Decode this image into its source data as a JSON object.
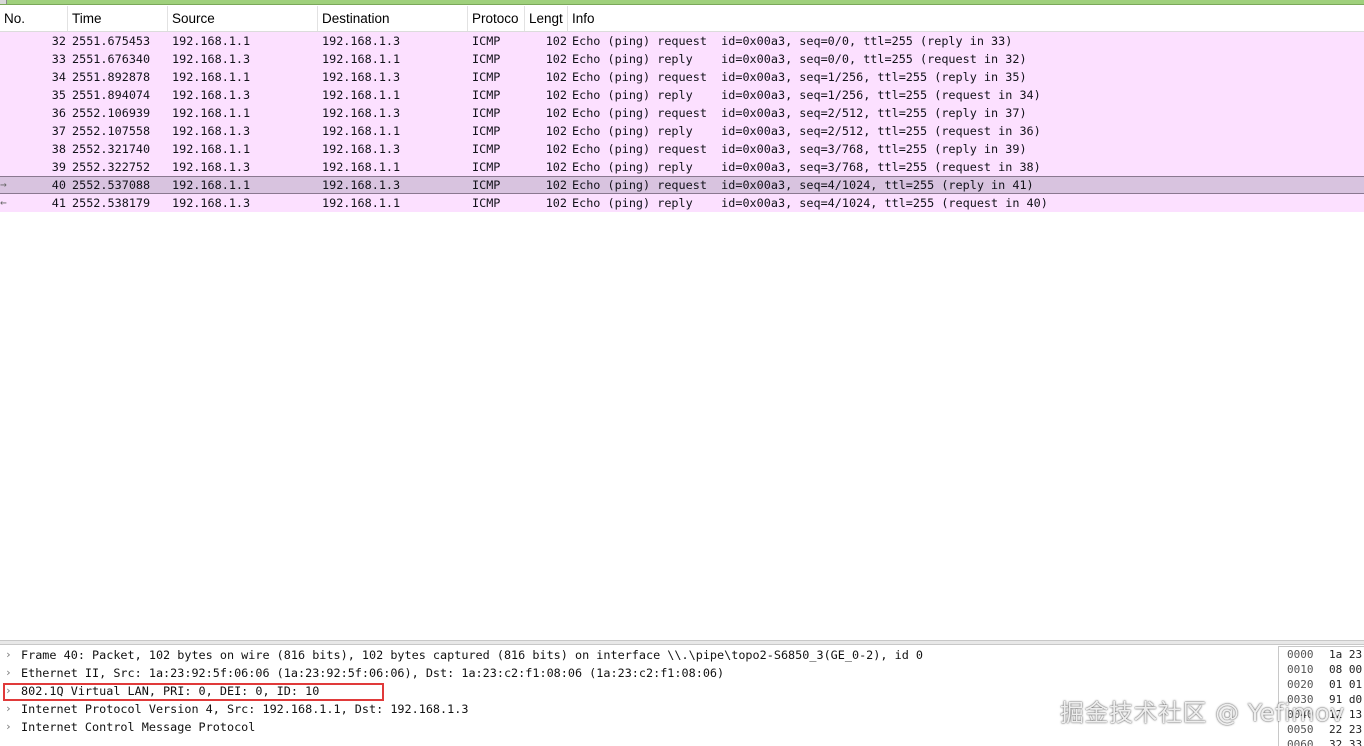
{
  "columns": {
    "no": "No.",
    "time": "Time",
    "source": "Source",
    "destination": "Destination",
    "protocol": "Protoco",
    "length": "Lengt",
    "info": "Info"
  },
  "packets": [
    {
      "no": "32",
      "time": "2551.675453",
      "src": "192.168.1.1",
      "dst": "192.168.1.3",
      "proto": "ICMP",
      "len": "102",
      "info": "Echo (ping) request  id=0x00a3, seq=0/0, ttl=255 (reply in 33)",
      "arrow": ""
    },
    {
      "no": "33",
      "time": "2551.676340",
      "src": "192.168.1.3",
      "dst": "192.168.1.1",
      "proto": "ICMP",
      "len": "102",
      "info": "Echo (ping) reply    id=0x00a3, seq=0/0, ttl=255 (request in 32)",
      "arrow": ""
    },
    {
      "no": "34",
      "time": "2551.892878",
      "src": "192.168.1.1",
      "dst": "192.168.1.3",
      "proto": "ICMP",
      "len": "102",
      "info": "Echo (ping) request  id=0x00a3, seq=1/256, ttl=255 (reply in 35)",
      "arrow": ""
    },
    {
      "no": "35",
      "time": "2551.894074",
      "src": "192.168.1.3",
      "dst": "192.168.1.1",
      "proto": "ICMP",
      "len": "102",
      "info": "Echo (ping) reply    id=0x00a3, seq=1/256, ttl=255 (request in 34)",
      "arrow": ""
    },
    {
      "no": "36",
      "time": "2552.106939",
      "src": "192.168.1.1",
      "dst": "192.168.1.3",
      "proto": "ICMP",
      "len": "102",
      "info": "Echo (ping) request  id=0x00a3, seq=2/512, ttl=255 (reply in 37)",
      "arrow": ""
    },
    {
      "no": "37",
      "time": "2552.107558",
      "src": "192.168.1.3",
      "dst": "192.168.1.1",
      "proto": "ICMP",
      "len": "102",
      "info": "Echo (ping) reply    id=0x00a3, seq=2/512, ttl=255 (request in 36)",
      "arrow": ""
    },
    {
      "no": "38",
      "time": "2552.321740",
      "src": "192.168.1.1",
      "dst": "192.168.1.3",
      "proto": "ICMP",
      "len": "102",
      "info": "Echo (ping) request  id=0x00a3, seq=3/768, ttl=255 (reply in 39)",
      "arrow": ""
    },
    {
      "no": "39",
      "time": "2552.322752",
      "src": "192.168.1.3",
      "dst": "192.168.1.1",
      "proto": "ICMP",
      "len": "102",
      "info": "Echo (ping) reply    id=0x00a3, seq=3/768, ttl=255 (request in 38)",
      "arrow": ""
    },
    {
      "no": "40",
      "time": "2552.537088",
      "src": "192.168.1.1",
      "dst": "192.168.1.3",
      "proto": "ICMP",
      "len": "102",
      "info": "Echo (ping) request  id=0x00a3, seq=4/1024, ttl=255 (reply in 41)",
      "arrow": "→",
      "selected": true
    },
    {
      "no": "41",
      "time": "2552.538179",
      "src": "192.168.1.3",
      "dst": "192.168.1.1",
      "proto": "ICMP",
      "len": "102",
      "info": "Echo (ping) reply    id=0x00a3, seq=4/1024, ttl=255 (request in 40)",
      "arrow": "←"
    }
  ],
  "details": [
    "Frame 40: Packet, 102 bytes on wire (816 bits), 102 bytes captured (816 bits) on interface \\\\.\\pipe\\topo2-S6850_3(GE_0-2), id 0",
    "Ethernet II, Src: 1a:23:92:5f:06:06 (1a:23:92:5f:06:06), Dst: 1a:23:c2:f1:08:06 (1a:23:c2:f1:08:06)",
    "802.1Q Virtual LAN, PRI: 0, DEI: 0, ID: 10",
    "Internet Protocol Version 4, Src: 192.168.1.1, Dst: 192.168.1.3",
    "Internet Control Message Protocol"
  ],
  "bytes": [
    {
      "offset": "0000",
      "hex": "1a 23"
    },
    {
      "offset": "0010",
      "hex": "08 00"
    },
    {
      "offset": "0020",
      "hex": "01 01"
    },
    {
      "offset": "0030",
      "hex": "91 d0"
    },
    {
      "offset": "0040",
      "hex": "12 13"
    },
    {
      "offset": "0050",
      "hex": "22 23"
    },
    {
      "offset": "0060",
      "hex": "32 33"
    }
  ],
  "watermark": "掘金技术社区 @ Yefimov",
  "colors": {
    "row_bg": "#fce0ff",
    "row_selected_bg": "#d8c3df",
    "highlight_border": "#e03a3a"
  }
}
